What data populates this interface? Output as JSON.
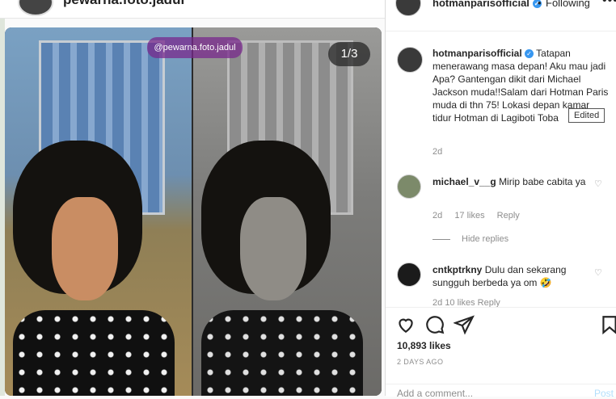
{
  "background": {
    "account": "pewarna.foto.jadul"
  },
  "photo": {
    "counter": "1/3",
    "watermark": "@pewarna.foto.jadul"
  },
  "header": {
    "username": "hotmanparisofficial",
    "separator": "•",
    "follow_label": "Following",
    "more_label": "•••"
  },
  "caption": {
    "username": "hotmanparisofficial",
    "text": "Tatapan menerawang masa depan! Aku mau jadi Apa? Gantengan dikit dari Michael Jackson muda!!Salam dari Hotman Paris muda di thn 75! Lokasi depan kamar tidur Hotman di Lagiboti Toba",
    "time": "2d",
    "edited_tooltip": "Edited"
  },
  "comments": [
    {
      "username": "michael_v__g",
      "text": "Mirip babe cabita ya",
      "time": "2d",
      "likes": "17 likes",
      "reply": "Reply",
      "hide_replies": "Hide replies"
    },
    {
      "username": "cntkptrkny",
      "text": "Dulu dan sekarang sungguh berbeda ya om",
      "time": "2d",
      "likes": "10 likes",
      "reply": "Reply"
    }
  ],
  "actions": {
    "likes": "10,893 likes",
    "date": "2 DAYS AGO",
    "comment_placeholder": "Add a comment...",
    "post_label": "Post"
  },
  "colors": {
    "verified": "#3897f0",
    "muted_text": "#8e8e8e",
    "post_button": "#b2dffc"
  }
}
